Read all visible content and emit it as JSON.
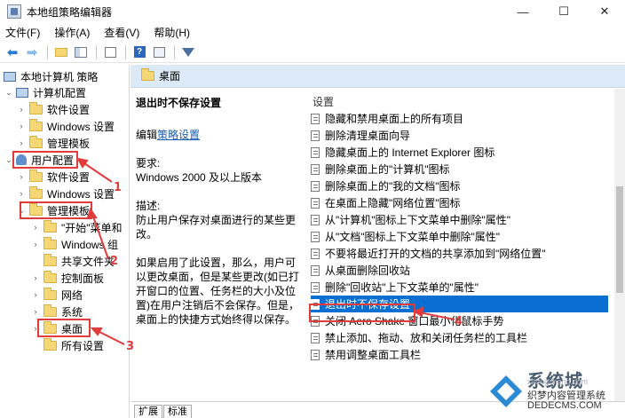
{
  "window": {
    "title": "本地组策略编辑器",
    "minimize": "—",
    "maximize": "☐",
    "close": "✕"
  },
  "menu": [
    "文件(F)",
    "操作(A)",
    "查看(V)",
    "帮助(H)"
  ],
  "tree": {
    "root": "本地计算机 策略",
    "computer_config": "计算机配置",
    "c_software": "软件设置",
    "c_windows": "Windows 设置",
    "c_admin": "管理模板",
    "user_config": "用户配置",
    "u_software": "软件设置",
    "u_windows": "Windows 设置",
    "u_admin": "管理模板",
    "start_menu": "\"开始\"菜单和",
    "windows_comp": "Windows 组",
    "shared": "共享文件夹",
    "control_panel": "控制面板",
    "network": "网络",
    "system": "系统",
    "desktop": "桌面",
    "all_settings": "所有设置"
  },
  "right": {
    "header": "桌面",
    "desc_title": "退出时不保存设置",
    "edit_prefix": "编辑",
    "edit_link": "策略设置",
    "req_label": "要求:",
    "req_value": "Windows 2000 及以上版本",
    "desc_label": "描述:",
    "desc_text": "防止用户保存对桌面进行的某些更改。",
    "desc_more": "如果启用了此设置，那么，用户可以更改桌面，但是某些更改(如已打开窗口的位置、任务栏的大小及位置)在用户注销后不会保存。但是，桌面上的快捷方式始终得以保存。",
    "settings_header": "设置",
    "settings": [
      "隐藏和禁用桌面上的所有项目",
      "删除清理桌面向导",
      "隐藏桌面上的 Internet Explorer 图标",
      "删除桌面上的\"计算机\"图标",
      "删除桌面上的\"我的文档\"图标",
      "在桌面上隐藏\"网络位置\"图标",
      "从\"计算机\"图标上下文菜单中删除\"属性\"",
      "从\"文档\"图标上下文菜单中删除\"属性\"",
      "不要将最近打开的文档的共享添加到\"网络位置\"",
      "从桌面删除回收站",
      "删除\"回收站\"上下文菜单的\"属性\"",
      "退出时不保存设置",
      "关闭 Aero Shake 窗口最小化鼠标手势",
      "禁止添加、拖动、放和关闭任务栏的工具栏",
      "禁用调整桌面工具栏"
    ],
    "tabs": [
      "扩展",
      "标准"
    ]
  },
  "annotations": [
    "1",
    "2",
    "3",
    "4"
  ],
  "watermark": {
    "brand": "系统城",
    "sub": "织梦内容管理系统",
    "site": "DEDECMS.COM",
    "url": "xitongcheng.com"
  },
  "colors": {
    "selection": "#0a6fd0",
    "annotation": "#e23b3b",
    "header": "#dce9f7"
  }
}
